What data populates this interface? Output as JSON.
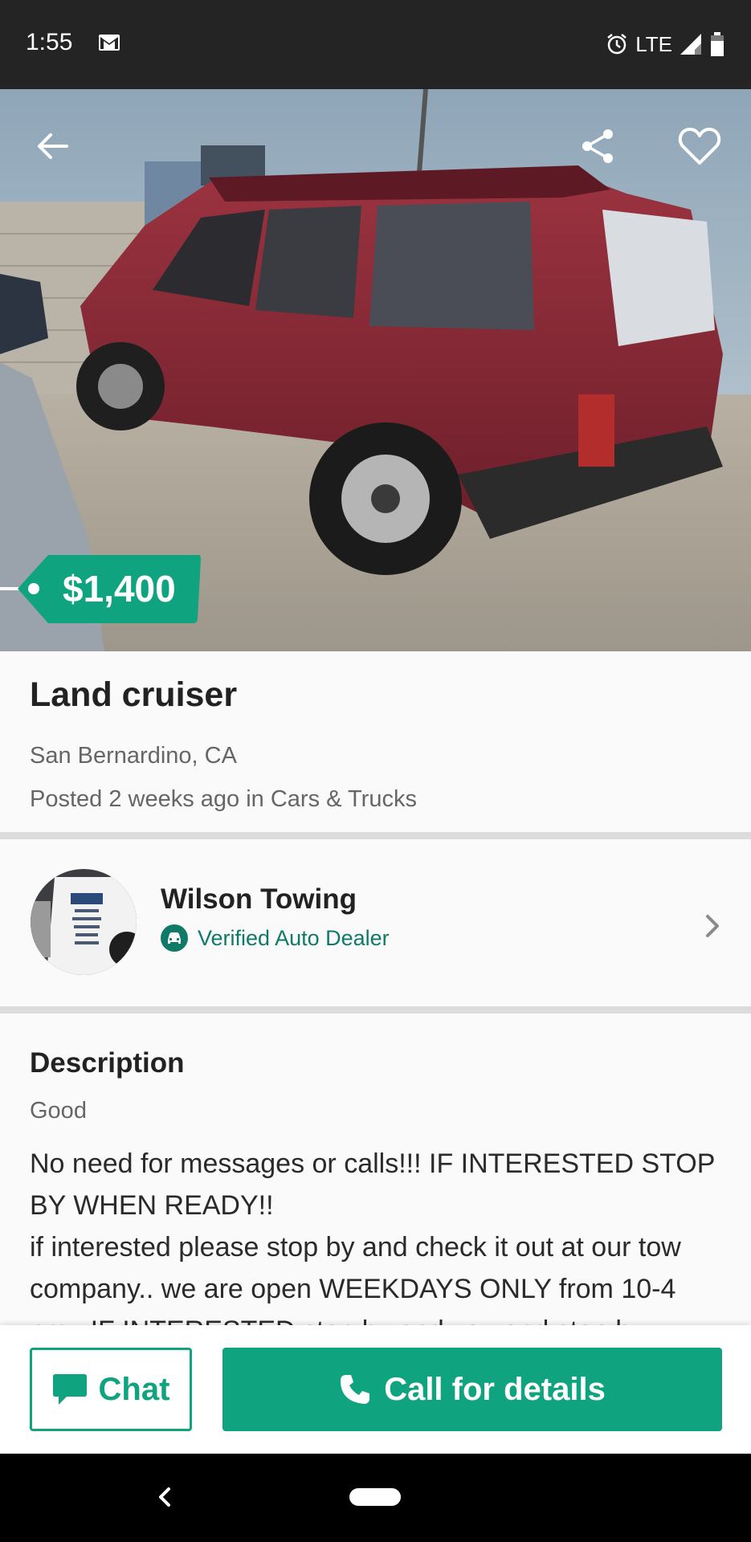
{
  "status_bar": {
    "time": "1:55",
    "network": "LTE",
    "icons": [
      "gmail-icon",
      "alarm-icon",
      "signal-icon",
      "battery-icon"
    ]
  },
  "hero": {
    "image_description_icon": "vehicle-photo",
    "price": "$1,400",
    "icons": [
      "back-arrow-icon",
      "share-icon",
      "heart-icon"
    ]
  },
  "listing": {
    "title": "Land cruiser",
    "location": "San Bernardino, CA",
    "posted": "Posted 2 weeks ago in Cars & Trucks"
  },
  "seller": {
    "name": "Wilson Towing",
    "badge": "Verified Auto Dealer",
    "icons": [
      "car-badge-icon",
      "chevron-right-icon"
    ]
  },
  "description": {
    "heading": "Description",
    "condition": "Good",
    "body": "No need for messages or calls!!! IF INTERESTED STOP BY WHEN READY!!\nif interested please stop by and check it out at our tow company.. we are open WEEKDAYS ONLY from 10-4 pm.. IF INTERESTED stop by and you and stop by"
  },
  "actions": {
    "chat_label": "Chat",
    "call_label": "Call for details"
  },
  "colors": {
    "accent": "#10a37f",
    "verified": "#0f7a67",
    "status_bar": "#242424"
  }
}
